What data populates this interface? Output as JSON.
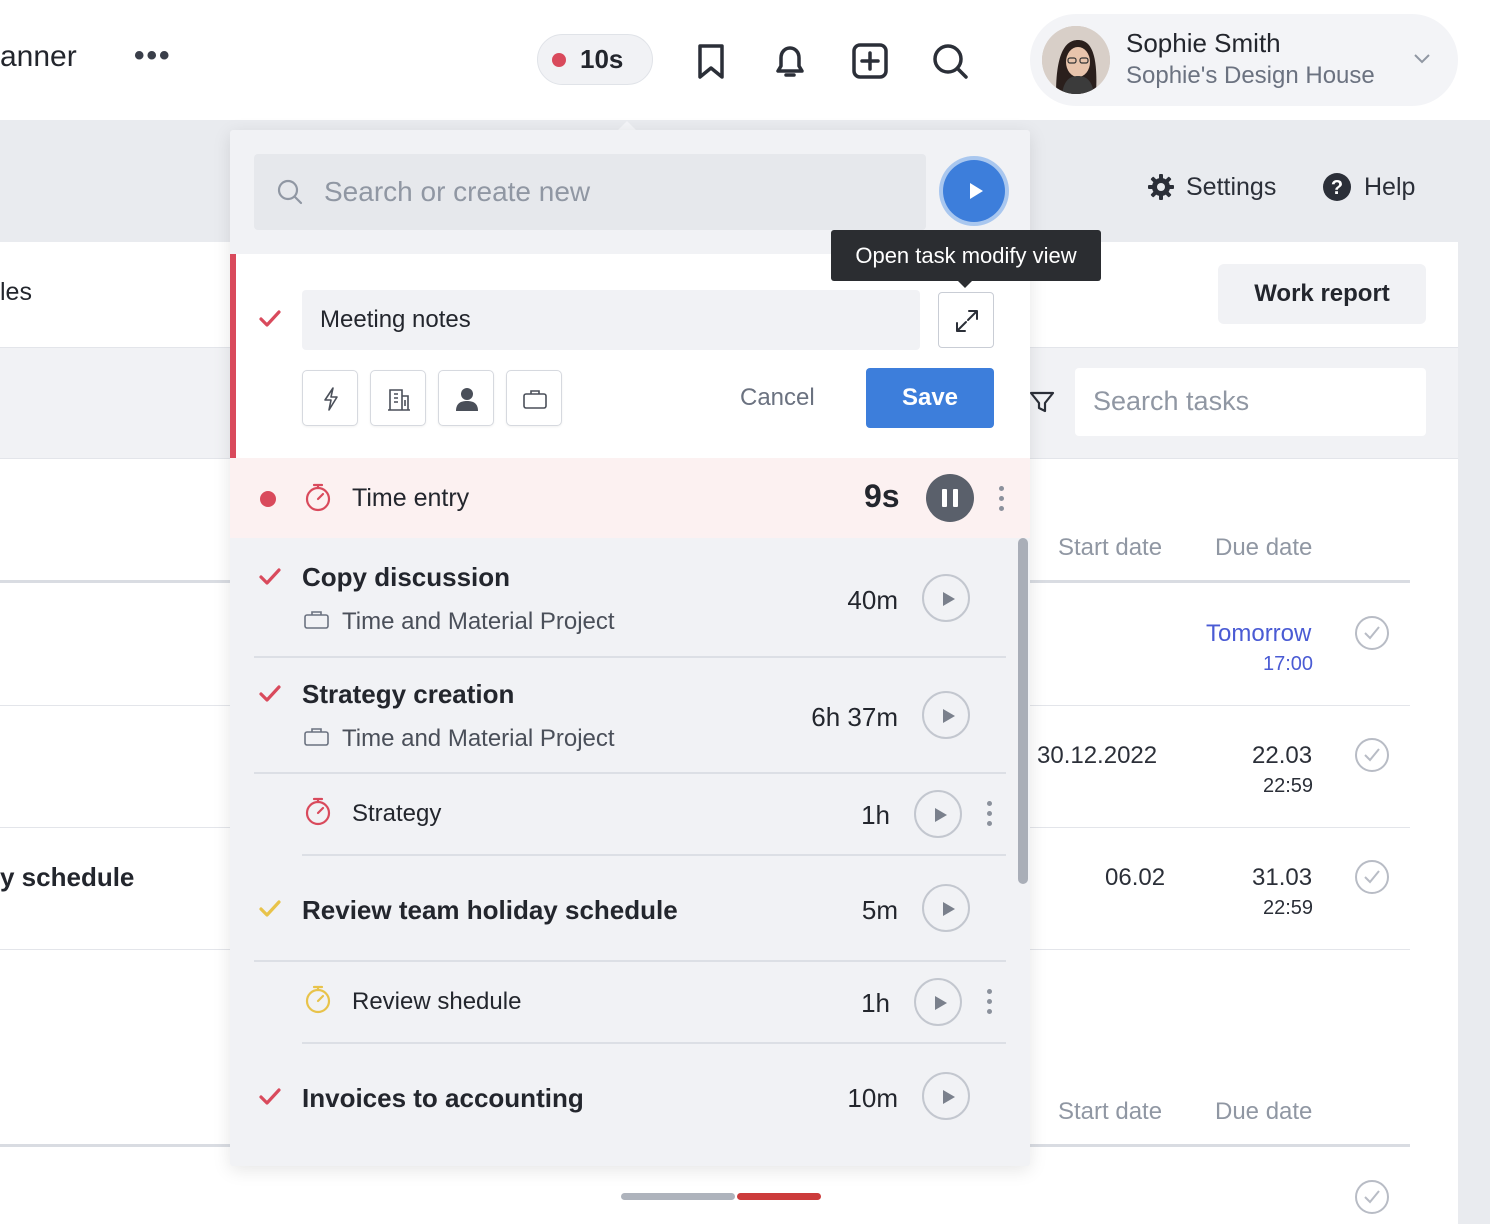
{
  "header": {
    "app_title_partial": "anner",
    "timer": "10s",
    "user": {
      "name": "Sophie Smith",
      "workspace": "Sophie's Design House"
    }
  },
  "toolbar": {
    "settings": "Settings",
    "help": "Help"
  },
  "page": {
    "tab_partial": "les",
    "work_report": "Work report",
    "search_tasks_placeholder": "Search tasks",
    "columns": {
      "start": "Start date",
      "due": "Due date"
    },
    "rows": [
      {
        "start": "",
        "due": "Tomorrow",
        "due_time": "17:00"
      },
      {
        "start": "30.12.2022",
        "due": "22.03",
        "due_time": "22:59"
      },
      {
        "title_partial": "y schedule",
        "start": "06.02",
        "due": "31.03",
        "due_time": "22:59"
      }
    ]
  },
  "popover": {
    "search_placeholder": "Search or create new",
    "tooltip": "Open task modify view",
    "task_name": "Meeting notes",
    "cancel": "Cancel",
    "save": "Save",
    "time_entry": {
      "label": "Time entry",
      "time": "9s"
    },
    "tasks": [
      {
        "title": "Copy discussion",
        "project": "Time and Material Project",
        "duration": "40m",
        "check_color": "#d94a5c"
      },
      {
        "title": "Strategy creation",
        "project": "Time and Material Project",
        "duration": "6h 37m",
        "check_color": "#d94a5c",
        "entry": {
          "label": "Strategy",
          "duration": "1h"
        }
      },
      {
        "title": "Review team holiday schedule",
        "duration": "5m",
        "check_color": "#e8c34a",
        "entry": {
          "label": "Review shedule",
          "duration": "1h"
        }
      },
      {
        "title": "Invoices to accounting",
        "duration": "10m",
        "check_color": "#d94a5c"
      }
    ]
  },
  "colors": {
    "accent": "#3d7edb",
    "recording": "#d94a5c",
    "pending": "#e8c34a"
  }
}
